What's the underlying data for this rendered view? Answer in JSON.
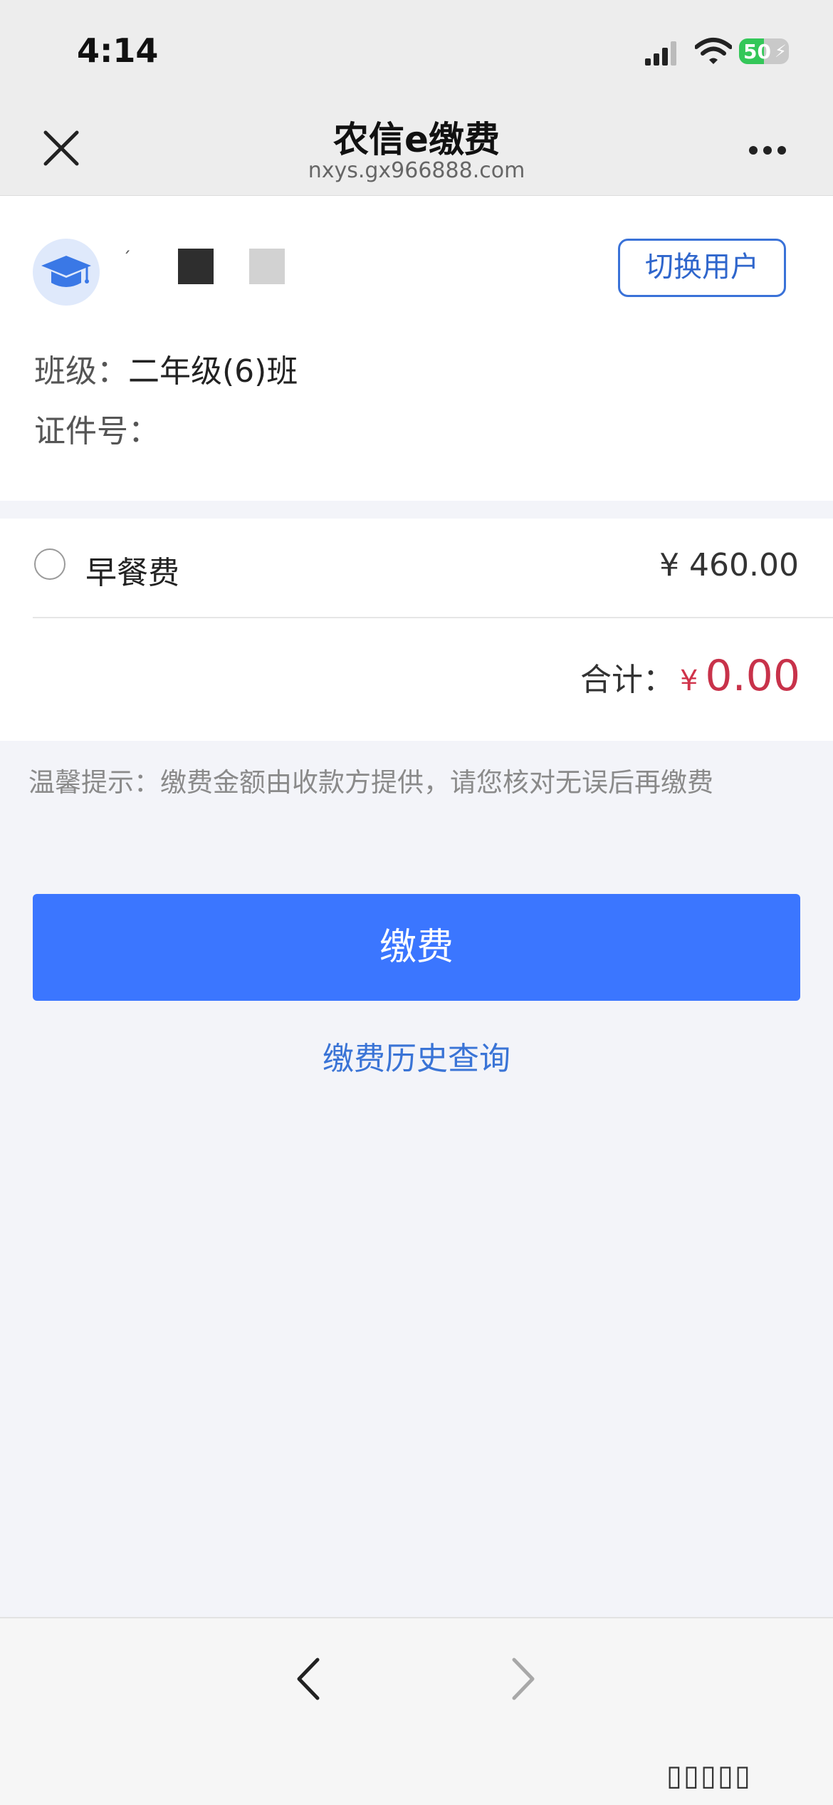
{
  "status_bar": {
    "time": "4:14",
    "battery": "50"
  },
  "nav": {
    "title": "农信e缴费",
    "url": "nxys.gx966888.com"
  },
  "user": {
    "switch_label": "切换用户",
    "class_label": "班级：",
    "class_value": "二年级(6)班",
    "id_label": "证件号：",
    "id_value": ""
  },
  "fee": {
    "item_name": "早餐费",
    "item_amount": "¥ 460.00",
    "total_label": "合计：",
    "total_currency": "¥",
    "total_value": "0.00"
  },
  "tip": "温馨提示：缴费金额由收款方提供，请您核对无误后再缴费",
  "actions": {
    "pay_label": "缴费",
    "history_label": "缴费历史查询"
  },
  "colors": {
    "primary": "#3b76ff",
    "link": "#3a74d6",
    "total": "#c8324a",
    "battery": "#34c759"
  }
}
